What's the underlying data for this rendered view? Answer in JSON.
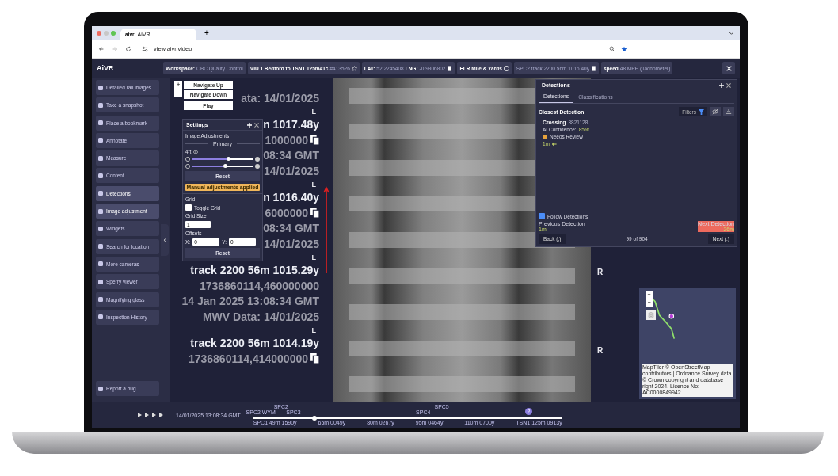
{
  "browser": {
    "tab_title": "AiVR",
    "favicon_text": "aivr",
    "new_tab": "+",
    "url": "view.aivr.video"
  },
  "app_header": {
    "logo": "AiVR",
    "chips": [
      {
        "kind": "plain",
        "label": "Workspace:",
        "value": "OBC Quality Control"
      },
      {
        "kind": "star",
        "label": "VIU 1 Bedford to TSN1 125m41c",
        "value": "#413526"
      },
      {
        "kind": "copy",
        "label": "LAT:",
        "value": "52.2245408",
        "label_2": "LNG:",
        "value_2": "-0.9306802"
      },
      {
        "kind": "info",
        "label": "ELR Mile & Yards"
      },
      {
        "kind": "copy",
        "value": "SPC2 track 2200 56m 1016.40y"
      },
      {
        "kind": "plain",
        "label": "speed",
        "value": "48 MPH (Tachometer)"
      }
    ]
  },
  "sidebar": {
    "items": [
      {
        "label": "Detailed rail images",
        "selected": false
      },
      {
        "label": "Take a snapshot",
        "selected": false
      },
      {
        "label": "Place a bookmark",
        "selected": false
      },
      {
        "label": "Annotate",
        "selected": false
      },
      {
        "label": "Measure",
        "selected": false
      },
      {
        "label": "Content",
        "selected": false
      },
      {
        "label": "Detections",
        "selected": true
      },
      {
        "label": "Image adjustment",
        "selected": true
      },
      {
        "label": "Widgets",
        "selected": false
      },
      {
        "label": "Search for location",
        "selected": false
      },
      {
        "label": "More cameras",
        "selected": false
      },
      {
        "label": "Sperry viewer",
        "selected": false
      },
      {
        "label": "Magnifying glass",
        "selected": false
      },
      {
        "label": "Inspection History",
        "selected": false
      }
    ],
    "bottom_item": {
      "label": "Report a bug"
    },
    "collapse": "‹"
  },
  "navigation": {
    "zoom_in": "+",
    "zoom_out": "−",
    "up": "Navigate Up",
    "down": "Navigate Down",
    "play": "Play"
  },
  "overlay_lines": [
    {
      "kind": "small",
      "text": "ata: 14/01/2025",
      "copy_icon": false
    },
    {
      "kind": "marker",
      "text": "L",
      "copy_icon": false
    },
    {
      "kind": "big",
      "text": "n 1017.48y",
      "copy_icon": false
    },
    {
      "kind": "small",
      "text": "1000000",
      "copy_icon": true
    },
    {
      "kind": "small",
      "text": "08:34 GMT",
      "copy_icon": false
    },
    {
      "kind": "small",
      "text": "14/01/2025",
      "copy_icon": false
    },
    {
      "kind": "marker",
      "text": "L",
      "copy_icon": false
    },
    {
      "kind": "big",
      "text": "n 1016.40y",
      "copy_icon": false
    },
    {
      "kind": "small",
      "text": "6000000",
      "copy_icon": true
    },
    {
      "kind": "small",
      "text": "08:34 GMT",
      "copy_icon": false
    },
    {
      "kind": "small",
      "text": "14/01/2025",
      "copy_icon": false
    },
    {
      "kind": "marker",
      "text": "L",
      "copy_icon": false
    },
    {
      "kind": "big",
      "text": "track 2200 56m 1015.29y",
      "copy_icon": false
    },
    {
      "kind": "small",
      "text": "1736860114,460000000",
      "copy_icon": false
    },
    {
      "kind": "small",
      "text": "14 Jan 2025 13:08:34 GMT",
      "copy_icon": false
    },
    {
      "kind": "small",
      "text": "MWV Data: 14/01/2025",
      "copy_icon": false
    },
    {
      "kind": "marker",
      "text": "L",
      "copy_icon": false
    },
    {
      "kind": "big",
      "text": "track 2200 56m 1014.19y",
      "copy_icon": false
    },
    {
      "kind": "small",
      "text": "1736860114,414000000",
      "copy_icon": true
    }
  ],
  "right_markers": [
    "R",
    "R"
  ],
  "settings": {
    "title": "Settings",
    "section": "Image Adjustments",
    "camera": "Primary",
    "size_label": "4ft",
    "sliders": [
      {
        "level": 0.6
      },
      {
        "level": 0.55
      }
    ],
    "reset": "Reset",
    "notice": "Manual adjustments applied",
    "grid_title": "Grid",
    "toggle_grid": {
      "label": "Toggle Grid",
      "checked": false
    },
    "grid_size_label": "Grid Size",
    "grid_size": "1",
    "offsets_label": "Offsets",
    "x_label": "X:",
    "x_value": "0",
    "y_label": "Y:",
    "y_value": "0",
    "reset_2": "Reset"
  },
  "detections": {
    "title": "Detections",
    "tabs": [
      {
        "label": "Detections",
        "selected": true
      },
      {
        "label": "Classifications",
        "selected": false
      }
    ],
    "heading": "Closest Detection",
    "filters": "Filters",
    "type": "Crossing",
    "id": "3821128",
    "confidence_label": "AI Confidence:",
    "confidence": "85%",
    "review": "Needs Review",
    "distance": "1m",
    "follow": {
      "label": "Follow Detections",
      "checked": true
    },
    "previous_label": "Previous Detection",
    "previous_value": "1m",
    "next_label": "Next Detection",
    "next_value": "26m",
    "back": "Back (,)",
    "count": "99 of 904",
    "next": "Next (.)"
  },
  "map": {
    "zoom_in": "+",
    "zoom_out": "−",
    "attribution": "MapTiler © OpenStreetMap contributors | Ordnance Survey data © Crown copyright and database right 2024. Licence No: AC0000849942"
  },
  "timeline": {
    "datetime": "14/01/2025 13:08:34 GMT",
    "top_labels": [
      "SPC2",
      "WYM",
      "SPC3",
      "SPC4"
    ],
    "upper_labels": [
      "SPC2",
      "SPC5"
    ],
    "bottom_labels": [
      "SPC1 49m 1590y",
      "65m 0049y",
      "80m 0267y",
      "95m 0464y",
      "110m 0700y",
      "TSN1 125m 0913y"
    ],
    "badge": "2"
  }
}
